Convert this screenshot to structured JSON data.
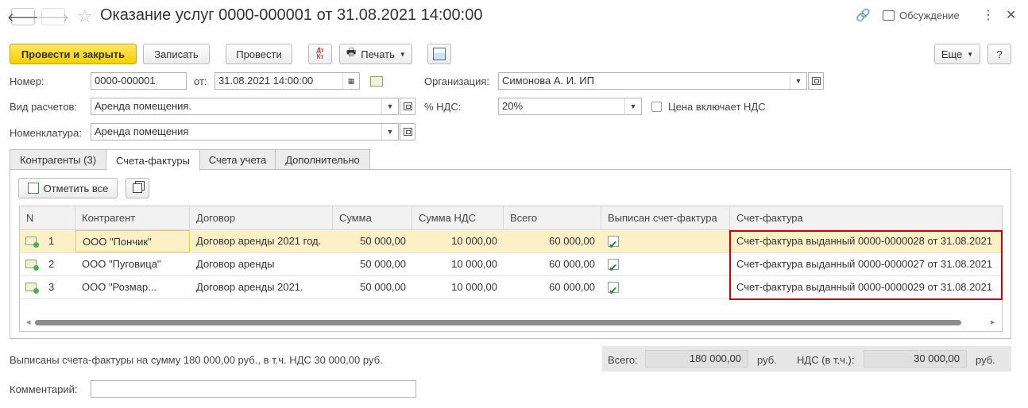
{
  "window": {
    "title": "Оказание услуг 0000-000001 от 31.08.2021 14:00:00",
    "discussion_label": "Обсуждение"
  },
  "toolbar": {
    "post_close_label": "Провести и закрыть",
    "save_label": "Записать",
    "post_label": "Провести",
    "dtkt_label": "Дт Кт",
    "print_label": "Печать",
    "more_label": "Еще",
    "help_label": "?"
  },
  "form": {
    "number_label": "Номер:",
    "number_value": "0000-000001",
    "date_label": "от:",
    "date_value": "31.08.2021 14:00:00",
    "org_label": "Организация:",
    "org_value": "Симонова А. И. ИП",
    "calc_type_label": "Вид расчетов:",
    "calc_type_value": "Аренда помещения.",
    "vat_label": "% НДС:",
    "vat_value": "20%",
    "price_includes_vat_label": "Цена включает НДС",
    "price_includes_vat_checked": false,
    "nomenclature_label": "Номенклатура:",
    "nomenclature_value": "Аренда помещения"
  },
  "tabs": [
    {
      "label": "Контрагенты (3)",
      "active": false
    },
    {
      "label": "Счета-фактуры",
      "active": true
    },
    {
      "label": "Счета учета",
      "active": false
    },
    {
      "label": "Дополнительно",
      "active": false
    }
  ],
  "panel": {
    "mark_all_label": "Отметить все"
  },
  "table": {
    "columns": [
      "N",
      "Контрагент",
      "Договор",
      "Сумма",
      "Сумма НДС",
      "Всего",
      "Выписан счет-фактура",
      "Счет-фактура"
    ],
    "rows": [
      {
        "n": "1",
        "counterparty": "ООО \"Пончик\"",
        "contract": "Договор аренды 2021 год.",
        "sum": "50 000,00",
        "vat": "10 000,00",
        "total": "60 000,00",
        "issued": true,
        "invoice": "Счет-фактура выданный 0000-0000028 от 31.08.2021"
      },
      {
        "n": "2",
        "counterparty": "ООО \"Пуговица\"",
        "contract": "Договор аренды",
        "sum": "50 000,00",
        "vat": "10 000,00",
        "total": "60 000,00",
        "issued": true,
        "invoice": "Счет-фактура выданный 0000-0000027 от 31.08.2021"
      },
      {
        "n": "3",
        "counterparty": "ООО \"Розмар...",
        "contract": "Договор аренды 2021.",
        "sum": "50 000,00",
        "vat": "10 000,00",
        "total": "60 000,00",
        "issued": true,
        "invoice": "Счет-фактура выданный 0000-0000029 от 31.08.2021"
      }
    ]
  },
  "footer": {
    "summary_text": "Выписаны счета-фактуры на сумму 180 000,00 руб., в т.ч. НДС 30 000,00 руб.",
    "total_label": "Всего:",
    "total_value": "180 000,00",
    "currency_1": "руб.",
    "vat_label": "НДС (в т.ч.):",
    "vat_value": "30 000,00",
    "currency_2": "руб.",
    "comment_label": "Комментарий:",
    "comment_value": ""
  },
  "colors": {
    "primary_button": "#f5d000",
    "selected_row": "#fbf0c6",
    "highlight_border": "#d40000",
    "check_green": "#1a8a3a"
  }
}
